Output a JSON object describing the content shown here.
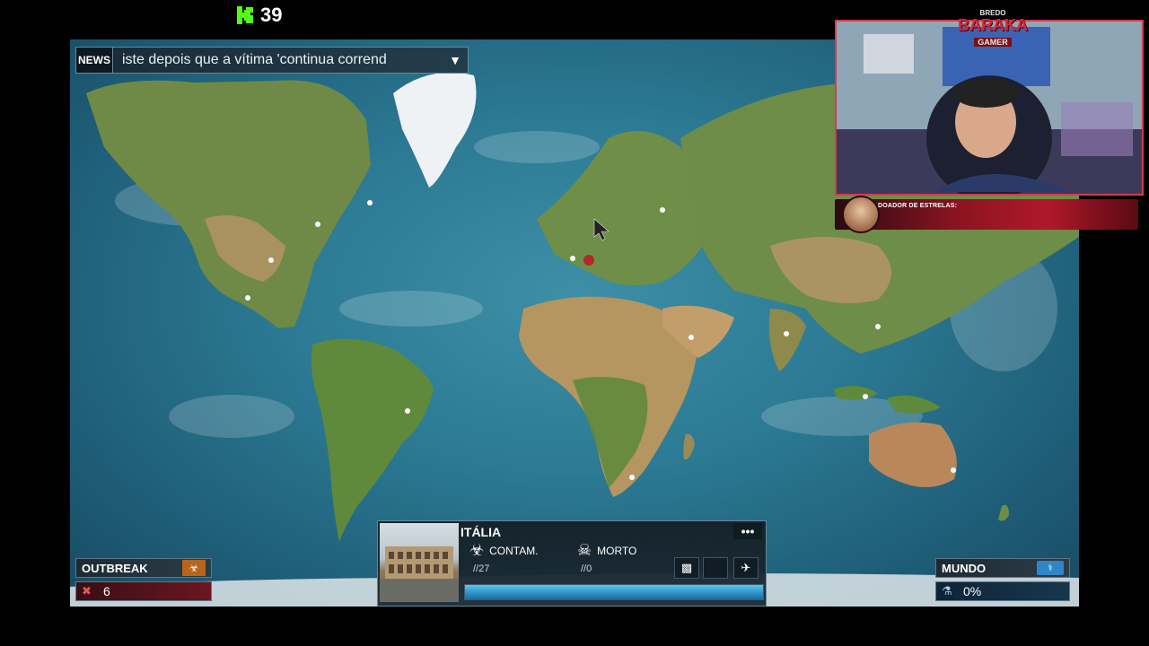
{
  "stream": {
    "viewer_count": "39",
    "brand": {
      "sub": "BREDO",
      "main": "BARAKA",
      "tag": "GAMER"
    },
    "donor_label": "DOADOR DE ESTRELAS:"
  },
  "news": {
    "label": "NEWS",
    "text": "iste depois que a vítima 'continua corrend"
  },
  "outbreak": {
    "title": "OUTBREAK",
    "value": "6"
  },
  "world": {
    "title": "MUNDO",
    "value": "0%"
  },
  "country": {
    "name": "ITÁLIA",
    "infected_label": "CONTAM.",
    "infected_count": "//27",
    "dead_label": "MORTO",
    "dead_count": "//0",
    "more_label": "•••",
    "infection_progress": 1.0
  },
  "colors": {
    "accent_red": "#d63a4e",
    "progress_blue": "#2b8fc4",
    "outbreak_orange": "#b6651a"
  }
}
